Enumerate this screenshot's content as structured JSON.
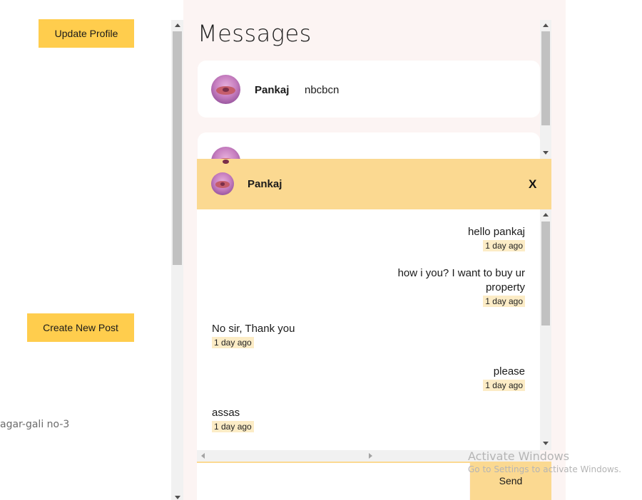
{
  "sidebar": {
    "update_profile_label": "Update Profile",
    "create_post_label": "Create New Post",
    "address_text": "agar-gali no-3"
  },
  "messages": {
    "title": "Messages",
    "conversations": [
      {
        "name": "Pankaj",
        "preview": "nbcbcn",
        "avatar_icon": "donut-avatar-icon"
      },
      {
        "name": "",
        "preview": "",
        "avatar_icon": "donut-avatar-icon"
      }
    ]
  },
  "chat": {
    "contact_name": "Pankaj",
    "close_label": "X",
    "messages": [
      {
        "side": "right",
        "text": "hello pankaj",
        "time": "1 day ago"
      },
      {
        "side": "right",
        "text": "how i you? I want to buy ur property",
        "time": "1 day ago"
      },
      {
        "side": "left",
        "text": "No sir, Thank you",
        "time": "1 day ago"
      },
      {
        "side": "right",
        "text": "please",
        "time": "1 day ago"
      },
      {
        "side": "left",
        "text": "assas",
        "time": "1 day ago"
      }
    ],
    "input_value": "",
    "send_label": "Send"
  },
  "os_watermark": {
    "line1": "Activate Windows",
    "line2": "Go to Settings to activate Windows."
  },
  "colors": {
    "accent": "#ffcd4d",
    "chat_header": "#fbd991",
    "panel_bg": "#fcf4f3",
    "time_badge": "#fcecc6"
  }
}
